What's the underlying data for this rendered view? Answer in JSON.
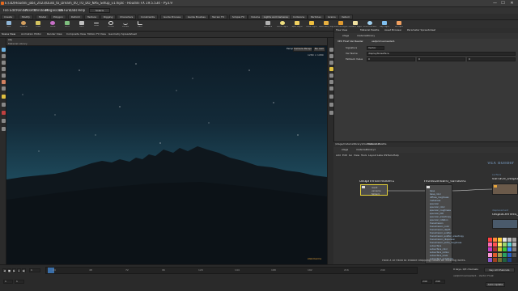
{
  "window": {
    "title": "E:/3D/Houdini_jobs_2023/Dusk_to_Dream_00_TO_DO_NAS_Setup_v1.hiplc - Houdini FX 19.5.534 - Py3.9",
    "min_label": "—",
    "max_label": "☐",
    "close_label": "✕"
  },
  "menu": [
    "File",
    "Edit",
    "Render",
    "Assets",
    "Windows",
    "Megascans",
    "DEFunc",
    "Labs",
    "Help"
  ],
  "desktop": "Solaris",
  "shelf_tabs": [
    "Create",
    "Modify",
    "Model",
    "Polygon",
    "Deform",
    "Texture",
    "Rigging",
    "Characters",
    "Constraints",
    "Guide Process",
    "Guide Brushes",
    "Terrain FX",
    "Simple FX",
    "Volume"
  ],
  "shelf_tools": [
    "Box",
    "Sphere",
    "Tube",
    "Torus",
    "Grid",
    "Null",
    "Line",
    "Circle",
    "Curve",
    "Path"
  ],
  "right_shelf_tabs": [
    "Lights and Cameras",
    "Collisions",
    "Particles",
    "Grains",
    "Vellum"
  ],
  "right_shelf_tools": [
    "Camera",
    "Point Light",
    "Spot Light",
    "Area Light",
    "Geometry Light",
    "Volume Light",
    "Distant Light",
    "Environment",
    "Sky Light",
    "GI Light"
  ],
  "left_pane": {
    "tabs": [
      "Scene View",
      "Animation Editor",
      "Render View",
      "Composite View",
      "Motion FX View",
      "Geometry Spreadsheet"
    ],
    "path": "obj",
    "viewport_label": "Material Library",
    "camera_menu": "Persp",
    "cam_label": "Camera Perspect",
    "display_label": "No cam",
    "corner_readout": "1280 × 1080",
    "render_label": "stab Karma"
  },
  "param_pane": {
    "tabs": [
      "Tree View",
      "Material Palette",
      "Asset Browser",
      "Parameter Spreadsheet"
    ],
    "path": "stage",
    "path2": "materiallibrary",
    "node_type": "VEX Float Var Reader",
    "node_name": "usdprimvarreader1",
    "rows": [
      {
        "label": "Signature",
        "value": "Vector"
      },
      {
        "label": "Var Name",
        "value": "displayNoiseFace"
      },
      {
        "label": "Fallback Value",
        "value": "0"
      }
    ]
  },
  "net_pane": {
    "tabs": [
      "/stage/materiallibrary1/karmatrumet",
      "Material Palette"
    ],
    "path": "stage",
    "path2": "materiallibrary1",
    "menu": [
      "Add",
      "Edit",
      "Go",
      "View",
      "Tools",
      "Layout",
      "Labs",
      "OSTools",
      "Help"
    ],
    "title": "VEX Builder",
    "nodes": {
      "reader": "usdprimvarreader1",
      "surface": "mtlxstandard_surface1",
      "output": "surface_output",
      "disp": "displacement_out",
      "disp_label": "displacement"
    },
    "surface_label": "surface",
    "hint": "Hold X or Padd to enable dropping nodes on existing wires.",
    "reader_ports": [
      "result",
      "varname",
      "fallback"
    ],
    "surface_ports": [
      "base",
      "base_color",
      "diffuse_roughness",
      "metalness",
      "specular",
      "specular_color",
      "specular_roughness",
      "specular_IOR",
      "specular_anisotropy",
      "specular_rotation",
      "transmission",
      "transmission_color",
      "transmission_depth",
      "transmission_scatter",
      "transmission_scatter_anisotropy",
      "transmission_dispersion",
      "transmission_extra_roughness",
      "subsurface",
      "subsurface_color",
      "subsurface_radius",
      "subsurface_scale",
      "subsurface_anisotropy",
      "sheen",
      "sheen_color",
      "sheen_roughness",
      "coat",
      "coat_color",
      "coat_roughness",
      "coat_anisotropy",
      "coat_rotation",
      "coat_IOR",
      "coat_normal",
      "coat_affect_color",
      "coat_affect_roughness",
      "thin_film_thickness",
      "thin_film_IOR",
      "emission",
      "emission_color",
      "opacity",
      "thin_walled",
      "normal",
      "tangent"
    ],
    "section_labels": [
      "Base",
      "Specular",
      "Transmission",
      "Subsurface",
      "Sheen",
      "Coat",
      "Thin Film",
      "Emission",
      "Geometry"
    ]
  },
  "palette_colors": [
    "#ff4040",
    "#ff8a3a",
    "#ffd23a",
    "#e6e6e6",
    "#c0c0c0",
    "#a0a0a0",
    "#ff6cb0",
    "#ff5050",
    "#fff06a",
    "#9bd66d",
    "#5ad2d2",
    "#b3b3b3",
    "#c83cc8",
    "#aa3030",
    "#c8c832",
    "#3cc83c",
    "#3c8cff",
    "#7f7f7f",
    "#ff9ad2",
    "#e05a2a",
    "#a0a050",
    "#2aa060",
    "#2a60c0",
    "#555555",
    "#8a5ac8",
    "#a04020",
    "#707030",
    "#206040",
    "#204080",
    "#2a2a2a"
  ],
  "timeline": {
    "frame": "1",
    "start": "1",
    "end": "240",
    "end2": "240",
    "ticks": [
      "24",
      "48",
      "72",
      "96",
      "120",
      "144",
      "168",
      "192",
      "216",
      "240"
    ],
    "keys_label": "0 keys, 0/0 channels",
    "key_all_label": "Key All Channels",
    "auto_update": "Auto Update",
    "status": "usdprimvarreader1 - Vector Float"
  },
  "accent_color": "#e6a43b"
}
